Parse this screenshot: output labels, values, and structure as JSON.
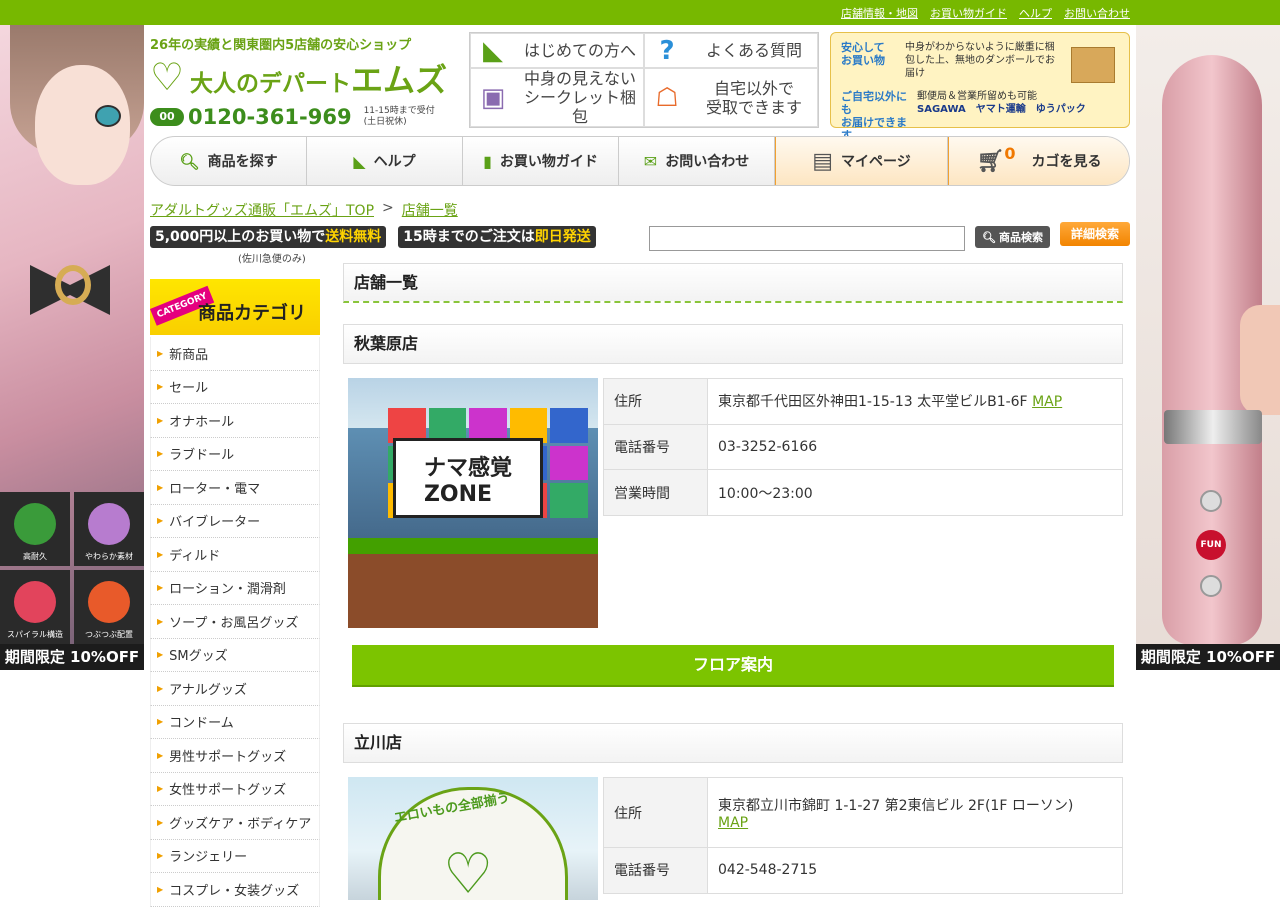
{
  "topbar": {
    "links": [
      "店舗情報・地図",
      "お買い物ガイド",
      "ヘルプ",
      "お問い合わせ"
    ]
  },
  "header": {
    "tagline": "26年の実績と関東圏内5店舗の安心ショップ",
    "logo_prefix": "大人のデパート",
    "logo_brand": "エムズ",
    "phone_icon": "00",
    "phone_number": "0120-361-969",
    "phone_hours_1": "11-15時まで受付",
    "phone_hours_2": "(土日祝休)",
    "services": [
      {
        "label": "はじめての方へ",
        "icon": "beginner-icon"
      },
      {
        "label": "よくある質問",
        "icon": "question-icon"
      },
      {
        "label": "中身の見えない\nシークレット梱包",
        "icon": "package-icon"
      },
      {
        "label": "自宅以外で\n受取できます",
        "icon": "delivery-icon"
      }
    ],
    "shipping_banner": {
      "row1_em": "安心して\nお買い物",
      "row1_text": "中身がわからないように厳重に梱包した上、無地のダンボールでお届け",
      "row2_em": "ご自宅以外にも\nお届けできます",
      "row2_text": "郵便局＆営業所留めも可能",
      "carriers": "SAGAWA　ヤマト運輸　ゆうパック"
    }
  },
  "nav": {
    "items": [
      "商品を探す",
      "ヘルプ",
      "お買い物ガイド",
      "お問い合わせ",
      "マイページ",
      "カゴを見る"
    ],
    "cart_count": "0"
  },
  "breadcrumb": {
    "home": "アダルトグッズ通販「エムズ」TOP",
    "sep": ">",
    "current": "店舗一覧"
  },
  "promo": {
    "free_ship_a": "5,000円以上のお買い物で",
    "free_ship_b": "送料無料",
    "same_day_a": "15時までのご注文は",
    "same_day_b": "即日発送",
    "note": "(佐川急便のみ)"
  },
  "search": {
    "placeholder": "",
    "button_label": "商品検索",
    "advanced_label": "詳細検索"
  },
  "sidebar": {
    "ribbon": "CATEGORY",
    "title": "商品カテゴリ",
    "items": [
      "新商品",
      "セール",
      "オナホール",
      "ラブドール",
      "ローター・電マ",
      "バイブレーター",
      "ディルド",
      "ローション・潤滑剤",
      "ソープ・お風呂グッズ",
      "SMグッズ",
      "アナルグッズ",
      "コンドーム",
      "男性サポートグッズ",
      "女性サポートグッズ",
      "グッズケア・ボディケア",
      "ランジェリー",
      "コスプレ・女装グッズ"
    ]
  },
  "banners": {
    "left_caption": "期間限定 10%OFF",
    "left_features": [
      "高耐久",
      "やわらか素材",
      "スパイラル構造",
      "つぶつぶ配置"
    ],
    "right_caption": "期間限定 10%OFF",
    "right_logo": "FUN"
  },
  "main": {
    "page_title": "店舗一覧",
    "stores": [
      {
        "name": "秋葉原店",
        "photo_sign": "ナマ感覚\nZONE",
        "rows": [
          {
            "key": "住所",
            "value": "東京都千代田区外神田1-15-13 太平堂ビルB1-6F",
            "link": "MAP"
          },
          {
            "key": "電話番号",
            "value": "03-3252-6166",
            "link": ""
          },
          {
            "key": "営業時間",
            "value": "10:00〜23:00",
            "link": ""
          }
        ],
        "floor_button": "フロア案内"
      },
      {
        "name": "立川店",
        "photo_sign": "エロいもの全部揃う",
        "rows": [
          {
            "key": "住所",
            "value": "東京都立川市錦町 1-1-27 第2東信ビル 2F(1F ローソン)",
            "link": "MAP"
          },
          {
            "key": "電話番号",
            "value": "042-548-2715",
            "link": ""
          }
        ]
      }
    ]
  },
  "colors": {
    "brand_green": "#77b800",
    "accent_orange": "#f28400",
    "link_green": "#6aa315"
  }
}
